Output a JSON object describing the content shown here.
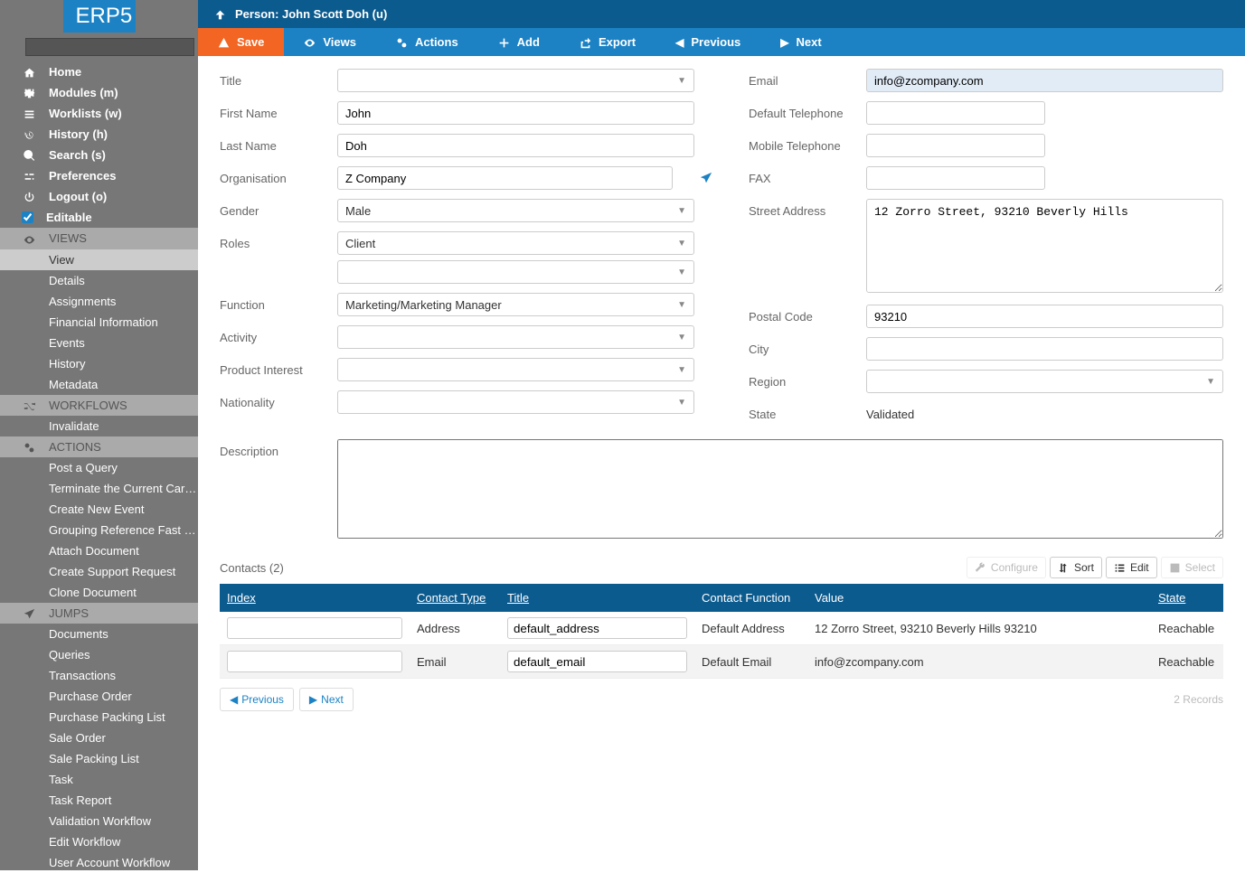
{
  "logo": "ERP5",
  "sidebar": {
    "nav": [
      {
        "icon": "home",
        "label": "Home"
      },
      {
        "icon": "puzzle",
        "label": "Modules (m)"
      },
      {
        "icon": "list",
        "label": "Worklists (w)"
      },
      {
        "icon": "history",
        "label": "History (h)"
      },
      {
        "icon": "search",
        "label": "Search (s)"
      },
      {
        "icon": "sliders",
        "label": "Preferences"
      },
      {
        "icon": "power",
        "label": "Logout (o)"
      },
      {
        "icon": "checkbox",
        "label": "Editable"
      }
    ],
    "sections": [
      {
        "icon": "eye",
        "title": "VIEWS",
        "items": [
          "View",
          "Details",
          "Assignments",
          "Financial Information",
          "Events",
          "History",
          "Metadata"
        ],
        "active": 0
      },
      {
        "icon": "random",
        "title": "WORKFLOWS",
        "items": [
          "Invalidate"
        ]
      },
      {
        "icon": "cogs",
        "title": "ACTIONS",
        "items": [
          "Post a Query",
          "Terminate the Current Career…",
          "Create New Event",
          "Grouping Reference Fast Input",
          "Attach Document",
          "Create Support Request",
          "Clone Document"
        ]
      },
      {
        "icon": "plane",
        "title": "JUMPS",
        "items": [
          "Documents",
          "Queries",
          "Transactions",
          "Purchase Order",
          "Purchase Packing List",
          "Sale Order",
          "Sale Packing List",
          "Task",
          "Task Report",
          "Validation Workflow",
          "Edit Workflow",
          "User Account Workflow"
        ]
      }
    ]
  },
  "topbar": {
    "title": "Person: John Scott Doh (u)"
  },
  "actions": {
    "save": "Save",
    "views": "Views",
    "actions_btn": "Actions",
    "add": "Add",
    "export": "Export",
    "previous": "Previous",
    "next": "Next"
  },
  "form": {
    "left": {
      "title_label": "Title",
      "title_value": "",
      "first_name_label": "First Name",
      "first_name_value": "John",
      "last_name_label": "Last Name",
      "last_name_value": "Doh",
      "organisation_label": "Organisation",
      "organisation_value": "Z Company",
      "gender_label": "Gender",
      "gender_value": "Male",
      "roles_label": "Roles",
      "roles_value": "Client",
      "roles_value2": "",
      "function_label": "Function",
      "function_value": "Marketing/Marketing Manager",
      "activity_label": "Activity",
      "activity_value": "",
      "product_interest_label": "Product Interest",
      "product_interest_value": "",
      "nationality_label": "Nationality",
      "nationality_value": ""
    },
    "right": {
      "email_label": "Email",
      "email_value": "info@zcompany.com",
      "default_tel_label": "Default Telephone",
      "default_tel_value": "",
      "mobile_tel_label": "Mobile Telephone",
      "mobile_tel_value": "",
      "fax_label": "FAX",
      "fax_value": "",
      "street_label": "Street Address",
      "street_value": "12 Zorro Street, 93210 Beverly Hills",
      "postal_label": "Postal Code",
      "postal_value": "93210",
      "city_label": "City",
      "city_value": "",
      "region_label": "Region",
      "region_value": "",
      "state_label": "State",
      "state_value": "Validated"
    },
    "description_label": "Description",
    "description_value": ""
  },
  "contacts": {
    "title": "Contacts (2)",
    "tools": {
      "configure": "Configure",
      "sort": "Sort",
      "edit": "Edit",
      "select": "Select"
    },
    "headers": [
      "Index",
      "Contact Type",
      "Title",
      "Contact Function",
      "Value",
      "State"
    ],
    "rows": [
      {
        "index": "",
        "type": "Address",
        "title": "default_address",
        "function": "Default Address",
        "value": "12 Zorro Street, 93210 Beverly Hills 93210",
        "state": "Reachable"
      },
      {
        "index": "",
        "type": "Email",
        "title": "default_email",
        "function": "Default Email",
        "value": "info@zcompany.com",
        "state": "Reachable"
      }
    ],
    "pager": {
      "previous": "Previous",
      "next": "Next",
      "records": "2 Records"
    }
  }
}
